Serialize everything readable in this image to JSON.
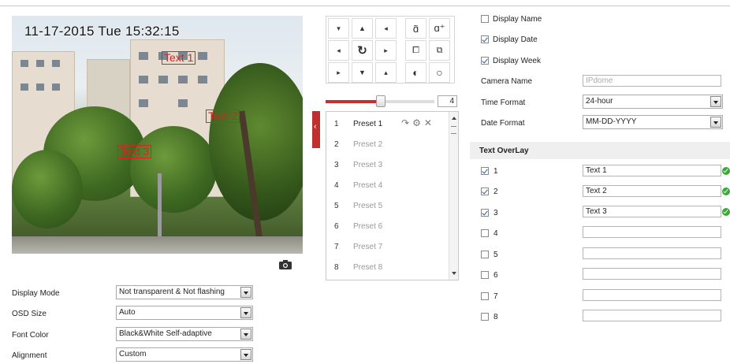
{
  "video": {
    "osd_datetime": "11-17-2015 Tue 15:32:15",
    "overlays": [
      "Text 1",
      "Text 2",
      "Text 3"
    ]
  },
  "settings": {
    "display_mode": {
      "label": "Display Mode",
      "value": "Not transparent & Not flashing"
    },
    "osd_size": {
      "label": "OSD Size",
      "value": "Auto"
    },
    "font_color": {
      "label": "Font Color",
      "value": "Black&White Self-adaptive"
    },
    "alignment": {
      "label": "Alignment",
      "value": "Custom"
    }
  },
  "ptz": {
    "speed": "4",
    "speed_level": 0.5,
    "icons": [
      "arrow-up-left-icon",
      "arrow-up-icon",
      "arrow-up-right-icon",
      "zoom-out-icon",
      "zoom-in-icon",
      "arrow-left-icon",
      "auto-pan-icon",
      "arrow-right-icon",
      "focus-near-icon",
      "focus-far-icon",
      "arrow-down-left-icon",
      "arrow-down-icon",
      "arrow-down-right-icon",
      "iris-close-icon",
      "iris-open-icon"
    ],
    "presets": [
      {
        "num": "1",
        "name": "Preset 1"
      },
      {
        "num": "2",
        "name": "Preset 2"
      },
      {
        "num": "3",
        "name": "Preset 3"
      },
      {
        "num": "4",
        "name": "Preset 4"
      },
      {
        "num": "5",
        "name": "Preset 5"
      },
      {
        "num": "6",
        "name": "Preset 6"
      },
      {
        "num": "7",
        "name": "Preset 7"
      },
      {
        "num": "8",
        "name": "Preset 8"
      }
    ]
  },
  "display": {
    "display_name": {
      "label": "Display Name",
      "checked": false
    },
    "display_date": {
      "label": "Display Date",
      "checked": true
    },
    "display_week": {
      "label": "Display Week",
      "checked": true
    },
    "camera_name": {
      "label": "Camera Name",
      "placeholder": "IPdome"
    },
    "time_format": {
      "label": "Time Format",
      "value": "24-hour"
    },
    "date_format": {
      "label": "Date Format",
      "value": "MM-DD-YYYY"
    }
  },
  "text_overlay": {
    "title": "Text OverLay",
    "items": [
      {
        "num": "1",
        "checked": true,
        "text": "Text 1"
      },
      {
        "num": "2",
        "checked": true,
        "text": "Text 2"
      },
      {
        "num": "3",
        "checked": true,
        "text": "Text 3"
      },
      {
        "num": "4",
        "checked": false,
        "text": ""
      },
      {
        "num": "5",
        "checked": false,
        "text": ""
      },
      {
        "num": "6",
        "checked": false,
        "text": ""
      },
      {
        "num": "7",
        "checked": false,
        "text": ""
      },
      {
        "num": "8",
        "checked": false,
        "text": ""
      }
    ]
  },
  "colors": {
    "accent": "#c9302c",
    "ok": "#3aaa35",
    "overlay_text": "#e02020"
  }
}
